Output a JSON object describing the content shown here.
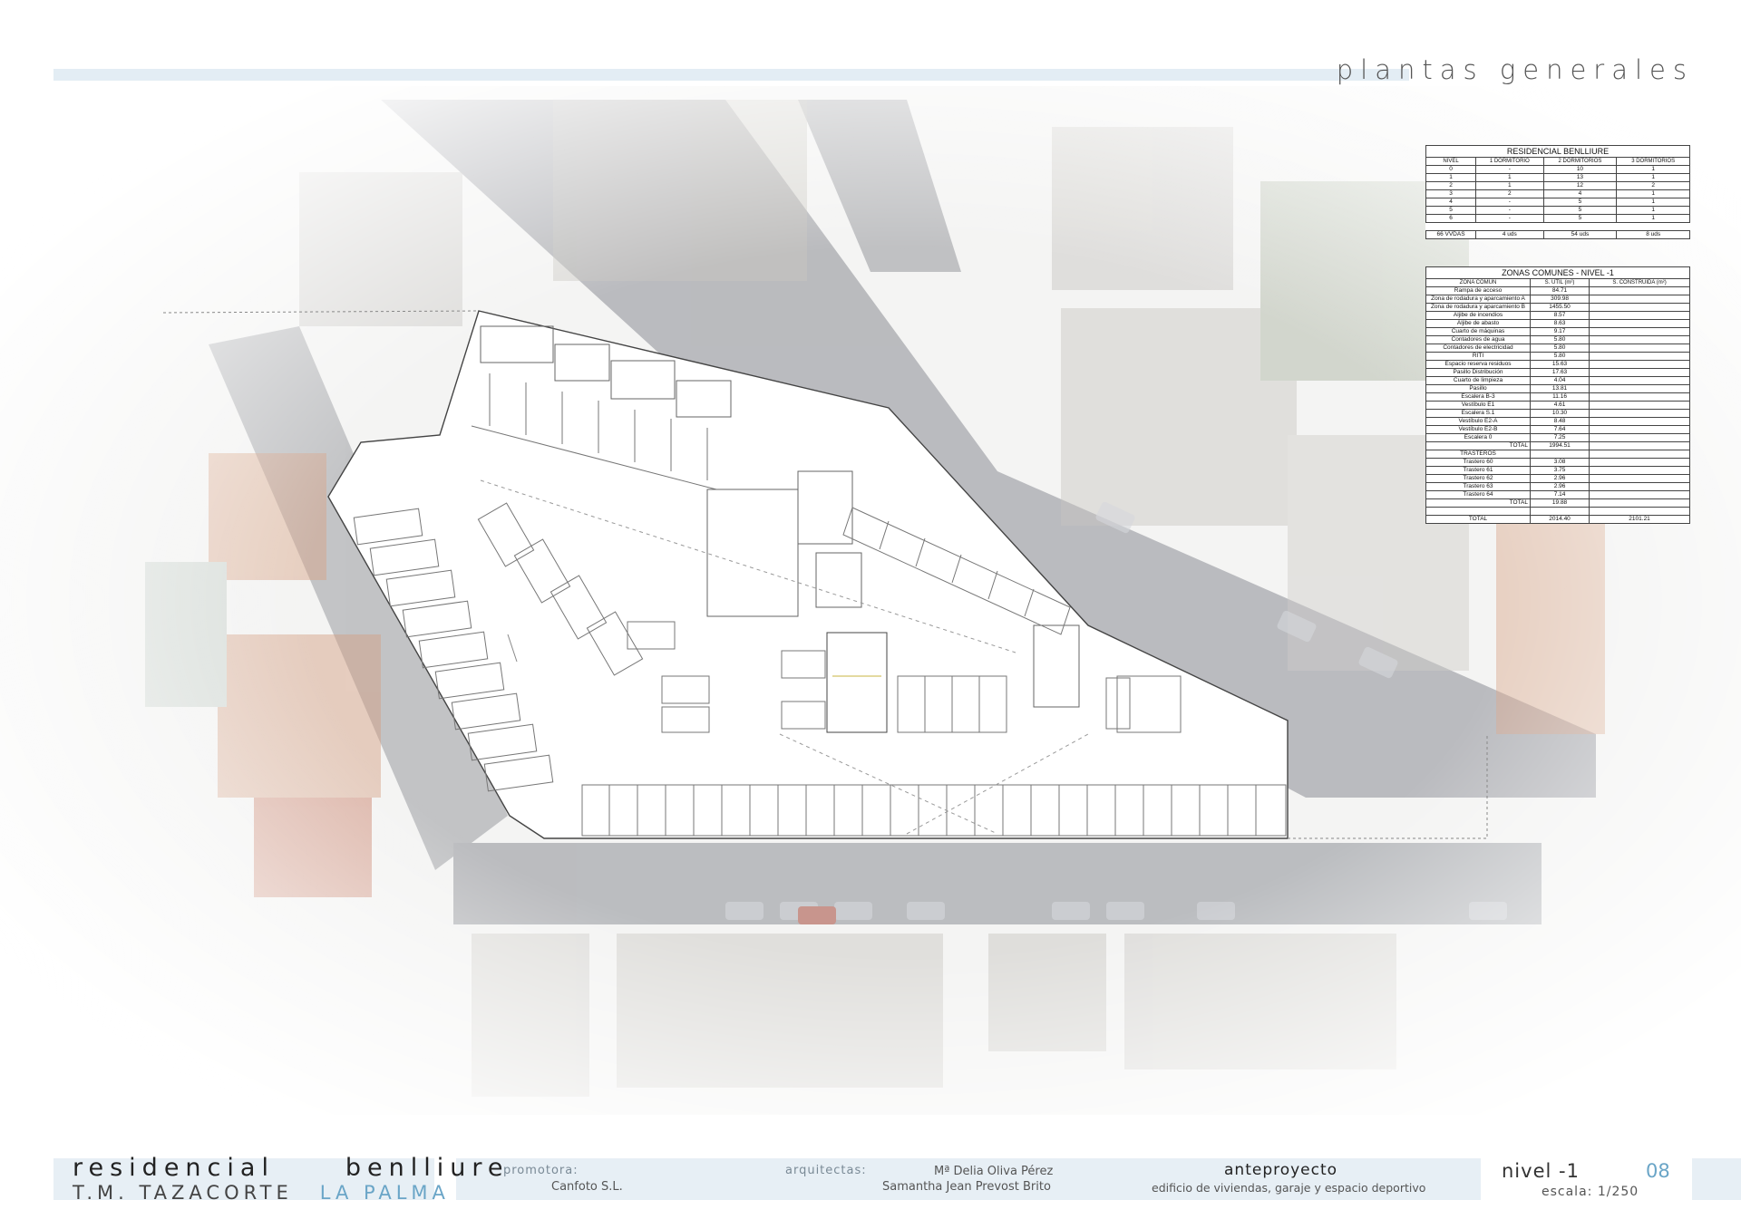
{
  "header": {
    "sheet_title": "plantas generales"
  },
  "units_table": {
    "title": "RESIDENCIAL BENLLIURE",
    "columns": [
      "NIVEL",
      "1 DORMITORIO",
      "2 DORMITORIOS",
      "3 DORMITORIOS"
    ],
    "rows": [
      [
        "0",
        "-",
        "10",
        "1"
      ],
      [
        "1",
        "1",
        "13",
        "1"
      ],
      [
        "2",
        "1",
        "12",
        "2"
      ],
      [
        "3",
        "2",
        "4",
        "1"
      ],
      [
        "4",
        "-",
        "5",
        "1"
      ],
      [
        "5",
        "-",
        "5",
        "1"
      ],
      [
        "6",
        "-",
        "5",
        "1"
      ]
    ],
    "totals": [
      "66 VVDAS",
      "4 uds",
      "54 uds",
      "8 uds"
    ]
  },
  "areas_table": {
    "title": "ZONAS COMUNES - NIVEL -1",
    "columns": [
      "ZONA COMÚN",
      "S. ÚTIL (m²)",
      "S. CONSTRUIDA (m²)"
    ],
    "rows": [
      [
        "Rampa de acceso",
        "84.71",
        ""
      ],
      [
        "Zona de rodadura y aparcamiento A",
        "309.98",
        ""
      ],
      [
        "Zona de rodadura y aparcamiento B",
        "1455.50",
        ""
      ],
      [
        "Aljibe de incendios",
        "8.57",
        ""
      ],
      [
        "Aljibe de abasto",
        "8.63",
        ""
      ],
      [
        "Cuarto de máquinas",
        "9.17",
        ""
      ],
      [
        "Contadores de agua",
        "5.80",
        ""
      ],
      [
        "Contadores de electricidad",
        "5.80",
        ""
      ],
      [
        "RITI",
        "5.80",
        ""
      ],
      [
        "Espacio reserva residuos",
        "15.63",
        ""
      ],
      [
        "Pasillo Distribución",
        "17.63",
        ""
      ],
      [
        "Cuarto de limpieza",
        "4.04",
        ""
      ],
      [
        "Pasillo",
        "13.81",
        ""
      ],
      [
        "Escalera B-3",
        "11.16",
        ""
      ],
      [
        "Vestíbulo E1",
        "4.61",
        ""
      ],
      [
        "Escalera S.1",
        "10.30",
        ""
      ],
      [
        "Vestíbulo E2-A",
        "8.48",
        ""
      ],
      [
        "Vestíbulo E2-B",
        "7.64",
        ""
      ],
      [
        "Escalera 0",
        "7.25",
        ""
      ],
      [
        "TOTAL",
        "1994.51",
        ""
      ],
      [
        "TRASTEROS",
        "",
        ""
      ],
      [
        "Trastero 60",
        "3.08",
        ""
      ],
      [
        "Trastero 61",
        "3.75",
        ""
      ],
      [
        "Trastero 62",
        "2.96",
        ""
      ],
      [
        "Trastero 63",
        "2.96",
        ""
      ],
      [
        "Trastero 64",
        "7.14",
        ""
      ],
      [
        "TOTAL",
        "19.88",
        ""
      ],
      [
        "",
        "",
        ""
      ],
      [
        "TOTAL",
        "2014.40",
        "2101.21"
      ]
    ]
  },
  "footer": {
    "project_name": "residencial     benlliure",
    "municipality": "T.M. TAZACORTE",
    "island": "LA PALMA",
    "promoter_label": "promotora:",
    "promoter_value": "Canfoto S.L.",
    "architects_label": "arquitectas:",
    "architect_1": "Mª Delia Oliva Pérez",
    "architect_2": "Samantha Jean Prevost Brito",
    "phase": "anteproyecto",
    "phase_description": "edificio de viviendas, garaje y espacio deportivo",
    "level": "nivel -1",
    "sheet_number": "08",
    "scale": "escala: 1/250"
  }
}
